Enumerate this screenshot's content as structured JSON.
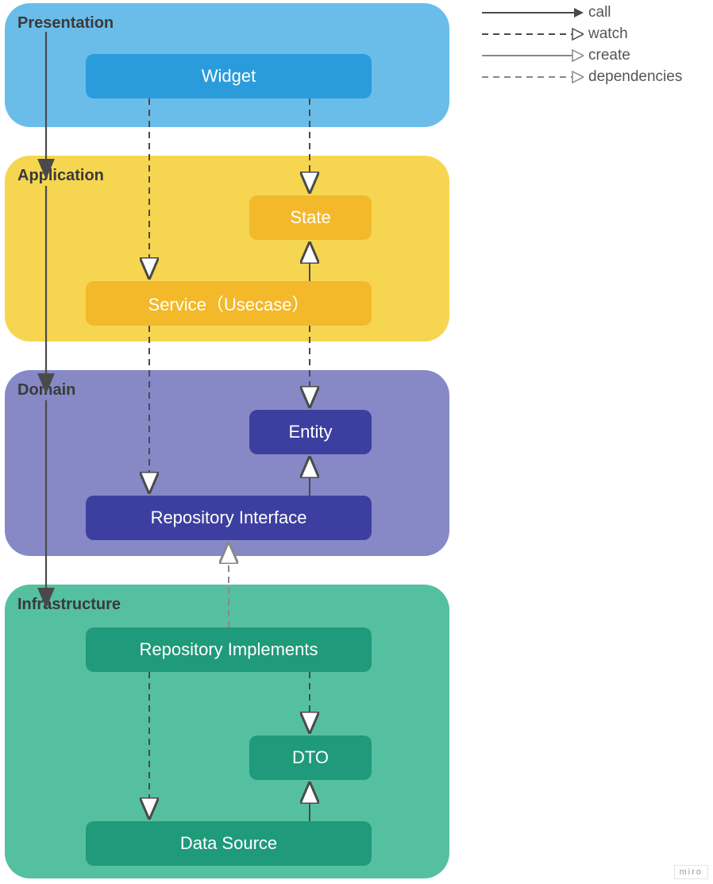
{
  "layers": {
    "presentation": {
      "title": "Presentation",
      "bg": "#6bbde9"
    },
    "application": {
      "title": "Application",
      "bg": "#f6d650"
    },
    "domain": {
      "title": "Domain",
      "bg": "#8689c6"
    },
    "infrastructure": {
      "title": "Infrastructure",
      "bg": "#55c0a0"
    }
  },
  "nodes": {
    "widget": {
      "label": "Widget",
      "bg": "#2a9cdc"
    },
    "state": {
      "label": "State",
      "bg": "#f3b92b"
    },
    "service": {
      "label": "Service（Usecase）",
      "bg": "#f3b92b"
    },
    "entity": {
      "label": "Entity",
      "bg": "#3d3fa0"
    },
    "repo_if": {
      "label": "Repository Interface",
      "bg": "#3d3fa0"
    },
    "repo_impl": {
      "label": "Repository Implements",
      "bg": "#1f9a7b"
    },
    "dto": {
      "label": "DTO",
      "bg": "#1f9a7b"
    },
    "data_source": {
      "label": "Data Source",
      "bg": "#1f9a7b"
    }
  },
  "legend": {
    "call": "call",
    "watch": "watch",
    "create": "create",
    "dependencies": "dependencies"
  },
  "arrows": {
    "color_dark": "#4a4a4a",
    "color_light": "#888888"
  },
  "watermark": "miro"
}
